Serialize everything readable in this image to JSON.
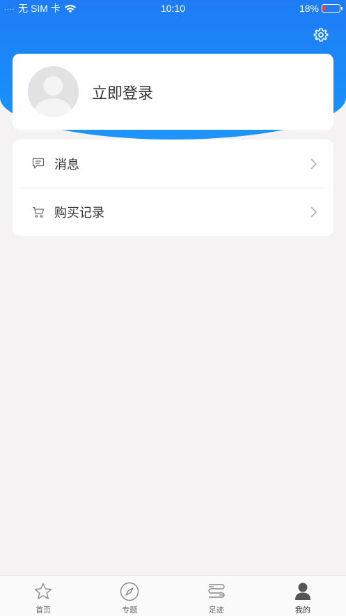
{
  "status_bar": {
    "signal": "....",
    "carrier": "无 SIM 卡",
    "time": "10:10",
    "battery_percent": "18%",
    "battery_level": 0.18
  },
  "header": {
    "settings_icon": "gear-icon"
  },
  "profile": {
    "login_label": "立即登录",
    "avatar_icon": "default-avatar"
  },
  "menu": {
    "items": [
      {
        "label": "消息",
        "icon": "message-icon"
      },
      {
        "label": "购买记录",
        "icon": "cart-icon"
      }
    ]
  },
  "tabbar": {
    "tabs": [
      {
        "label": "首页",
        "icon": "star-icon"
      },
      {
        "label": "专题",
        "icon": "compass-icon"
      },
      {
        "label": "足迹",
        "icon": "footprint-icon"
      },
      {
        "label": "我的",
        "icon": "user-icon",
        "active": true
      }
    ]
  },
  "colors": {
    "header_blue": "#1f7cf6",
    "background": "#f4f2f3",
    "battery_low": "#ff3b30"
  }
}
